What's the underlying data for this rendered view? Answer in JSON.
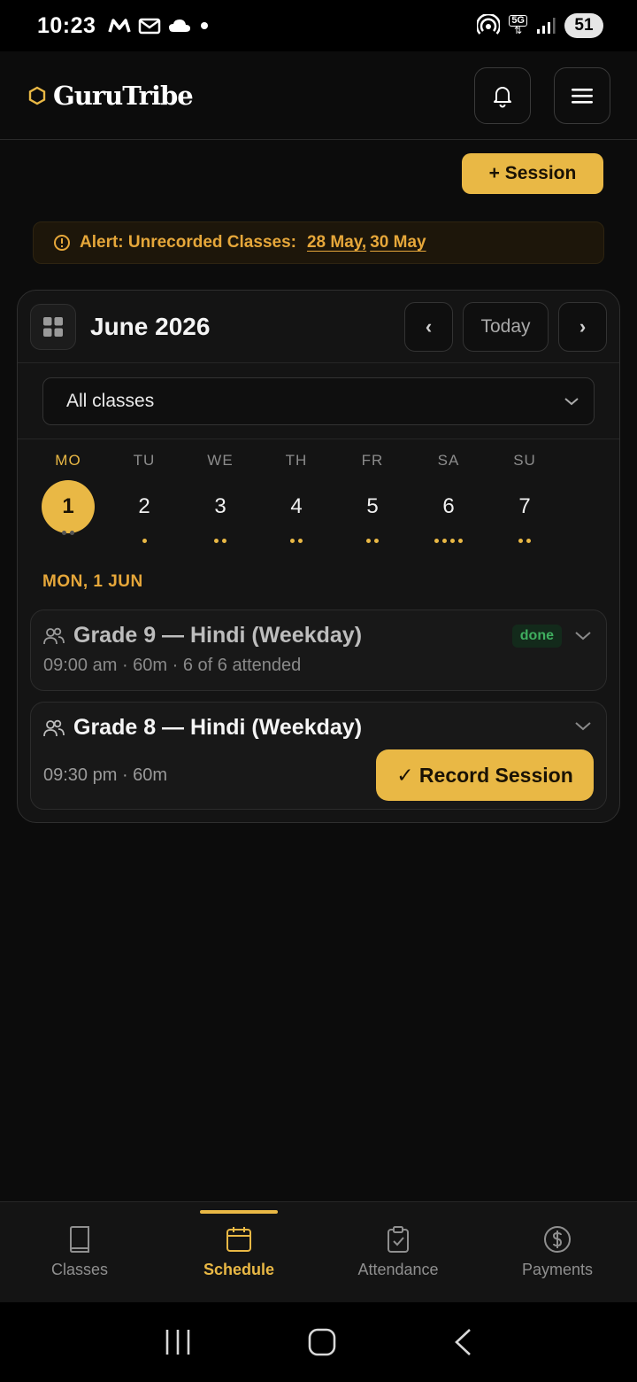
{
  "status_bar": {
    "time": "10:23",
    "left_icons": [
      "m-app-icon",
      "gmail-icon",
      "cloud-icon",
      "notification-dot-icon"
    ],
    "right_icons": [
      "hotspot-icon",
      "5g-icon",
      "signal-icon"
    ],
    "network": "5G",
    "battery": "51"
  },
  "header": {
    "brand": "GuruTribe",
    "brand_icon": "hexagon-icon",
    "accent_color": "#e9b845"
  },
  "actions": {
    "add_session_label": "+ Session"
  },
  "alert": {
    "label": "Alert: Unrecorded Classes:",
    "dates": [
      "28 May,",
      "30 May"
    ]
  },
  "calendar": {
    "month_title": "June 2026",
    "prev_label": "‹",
    "today_label": "Today",
    "next_label": "›",
    "filter_value": "All classes",
    "days": [
      {
        "label": "MO",
        "num": "1",
        "dots": 2,
        "active": true
      },
      {
        "label": "TU",
        "num": "2",
        "dots": 1
      },
      {
        "label": "WE",
        "num": "3",
        "dots": 2
      },
      {
        "label": "TH",
        "num": "4",
        "dots": 2
      },
      {
        "label": "FR",
        "num": "5",
        "dots": 2
      },
      {
        "label": "SA",
        "num": "6",
        "dots": 4
      },
      {
        "label": "SU",
        "num": "7",
        "dots": 2
      }
    ],
    "selected_date_heading": "MON, 1 JUN",
    "sessions": [
      {
        "title": "Grade 9 — Hindi (Weekday)",
        "meta": "09:00 am · 60m · 6 of 6 attended",
        "status": "done"
      },
      {
        "title": "Grade 8 — Hindi (Weekday)",
        "meta": "09:30 pm · 60m",
        "action_label": "✓ Record Session"
      }
    ]
  },
  "bottom_nav": {
    "items": [
      {
        "label": "Classes",
        "icon": "book-icon"
      },
      {
        "label": "Schedule",
        "icon": "calendar-icon",
        "active": true
      },
      {
        "label": "Attendance",
        "icon": "clipboard-check-icon"
      },
      {
        "label": "Payments",
        "icon": "dollar-circle-icon"
      }
    ]
  }
}
